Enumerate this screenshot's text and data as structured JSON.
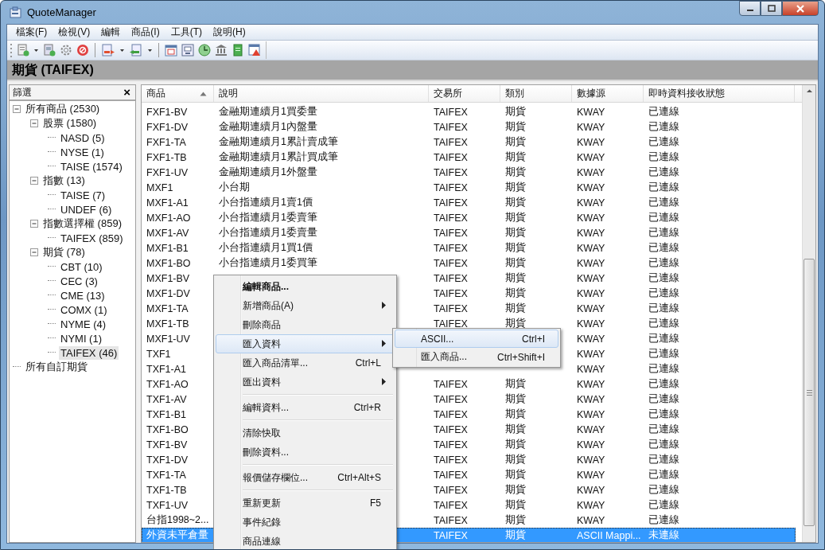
{
  "window": {
    "title": "QuoteManager"
  },
  "menu_bar": [
    {
      "label": "檔案(F)"
    },
    {
      "label": "檢視(V)"
    },
    {
      "label": "編輯"
    },
    {
      "label": "商品(I)"
    },
    {
      "label": "工具(T)"
    },
    {
      "label": "說明(H)"
    }
  ],
  "header": {
    "title": "期貨 (TAIFEX)"
  },
  "filter_panel": {
    "title": "篩選",
    "close": "×",
    "tree": [
      {
        "label": "所有商品 (2530)",
        "expanded": true,
        "selected": false,
        "children": [
          {
            "label": "股票 (1580)",
            "expanded": true,
            "selected": false,
            "children": [
              {
                "label": "NASD (5)",
                "selected": false
              },
              {
                "label": "NYSE (1)",
                "selected": false
              },
              {
                "label": "TAISE (1574)",
                "selected": false
              }
            ]
          },
          {
            "label": "指數 (13)",
            "expanded": true,
            "selected": false,
            "children": [
              {
                "label": "TAISE (7)",
                "selected": false
              },
              {
                "label": "UNDEF (6)",
                "selected": false
              }
            ]
          },
          {
            "label": "指數選擇權 (859)",
            "expanded": true,
            "selected": false,
            "children": [
              {
                "label": "TAIFEX (859)",
                "selected": false
              }
            ]
          },
          {
            "label": "期貨 (78)",
            "expanded": true,
            "selected": false,
            "children": [
              {
                "label": "CBT (10)",
                "selected": false
              },
              {
                "label": "CEC (3)",
                "selected": false
              },
              {
                "label": "CME (13)",
                "selected": false
              },
              {
                "label": "COMX (1)",
                "selected": false
              },
              {
                "label": "NYME (4)",
                "selected": false
              },
              {
                "label": "NYMI (1)",
                "selected": false
              },
              {
                "label": "TAIFEX (46)",
                "selected": true
              }
            ]
          }
        ]
      },
      {
        "label": "所有自訂期貨",
        "selected": false
      }
    ]
  },
  "table": {
    "columns": [
      {
        "label": "商品",
        "sorted": true
      },
      {
        "label": "說明",
        "sorted": false
      },
      {
        "label": "交易所",
        "sorted": false
      },
      {
        "label": "類別",
        "sorted": false
      },
      {
        "label": "數據源",
        "sorted": false
      },
      {
        "label": "即時資料接收狀態",
        "sorted": false
      }
    ],
    "rows": [
      {
        "cells": [
          "FXF1-BV",
          "金融期連續月1買委量",
          "TAIFEX",
          "期貨",
          "KWAY",
          "已連線"
        ],
        "selected": false
      },
      {
        "cells": [
          "FXF1-DV",
          "金融期連續月1內盤量",
          "TAIFEX",
          "期貨",
          "KWAY",
          "已連線"
        ],
        "selected": false
      },
      {
        "cells": [
          "FXF1-TA",
          "金融期連續月1累計賣成筆",
          "TAIFEX",
          "期貨",
          "KWAY",
          "已連線"
        ],
        "selected": false
      },
      {
        "cells": [
          "FXF1-TB",
          "金融期連續月1累計買成筆",
          "TAIFEX",
          "期貨",
          "KWAY",
          "已連線"
        ],
        "selected": false
      },
      {
        "cells": [
          "FXF1-UV",
          "金融期連續月1外盤量",
          "TAIFEX",
          "期貨",
          "KWAY",
          "已連線"
        ],
        "selected": false
      },
      {
        "cells": [
          "MXF1",
          "小台期",
          "TAIFEX",
          "期貨",
          "KWAY",
          "已連線"
        ],
        "selected": false
      },
      {
        "cells": [
          "MXF1-A1",
          "小台指連續月1賣1價",
          "TAIFEX",
          "期貨",
          "KWAY",
          "已連線"
        ],
        "selected": false
      },
      {
        "cells": [
          "MXF1-AO",
          "小台指連續月1委賣筆",
          "TAIFEX",
          "期貨",
          "KWAY",
          "已連線"
        ],
        "selected": false
      },
      {
        "cells": [
          "MXF1-AV",
          "小台指連續月1委賣量",
          "TAIFEX",
          "期貨",
          "KWAY",
          "已連線"
        ],
        "selected": false
      },
      {
        "cells": [
          "MXF1-B1",
          "小台指連續月1買1價",
          "TAIFEX",
          "期貨",
          "KWAY",
          "已連線"
        ],
        "selected": false
      },
      {
        "cells": [
          "MXF1-BO",
          "小台指連續月1委買筆",
          "TAIFEX",
          "期貨",
          "KWAY",
          "已連線"
        ],
        "selected": false
      },
      {
        "cells": [
          "MXF1-BV",
          null,
          "TAIFEX",
          "期貨",
          "KWAY",
          "已連線"
        ],
        "selected": false
      },
      {
        "cells": [
          "MXF1-DV",
          null,
          "TAIFEX",
          "期貨",
          "KWAY",
          "已連線"
        ],
        "selected": false
      },
      {
        "cells": [
          "MXF1-TA",
          null,
          "TAIFEX",
          "期貨",
          "KWAY",
          "已連線"
        ],
        "selected": false
      },
      {
        "cells": [
          "MXF1-TB",
          null,
          "TAIFEX",
          "期貨",
          "KWAY",
          "已連線"
        ],
        "selected": false
      },
      {
        "cells": [
          "MXF1-UV",
          null,
          null,
          null,
          "KWAY",
          "已連線"
        ],
        "selected": false
      },
      {
        "cells": [
          "TXF1",
          null,
          null,
          null,
          "KWAY",
          "已連線"
        ],
        "selected": false
      },
      {
        "cells": [
          "TXF1-A1",
          null,
          null,
          null,
          "KWAY",
          "已連線"
        ],
        "selected": false
      },
      {
        "cells": [
          "TXF1-AO",
          null,
          "TAIFEX",
          "期貨",
          "KWAY",
          "已連線"
        ],
        "selected": false
      },
      {
        "cells": [
          "TXF1-AV",
          null,
          "TAIFEX",
          "期貨",
          "KWAY",
          "已連線"
        ],
        "selected": false
      },
      {
        "cells": [
          "TXF1-B1",
          null,
          "TAIFEX",
          "期貨",
          "KWAY",
          "已連線"
        ],
        "selected": false
      },
      {
        "cells": [
          "TXF1-BO",
          null,
          "TAIFEX",
          "期貨",
          "KWAY",
          "已連線"
        ],
        "selected": false
      },
      {
        "cells": [
          "TXF1-BV",
          null,
          "TAIFEX",
          "期貨",
          "KWAY",
          "已連線"
        ],
        "selected": false
      },
      {
        "cells": [
          "TXF1-DV",
          null,
          "TAIFEX",
          "期貨",
          "KWAY",
          "已連線"
        ],
        "selected": false
      },
      {
        "cells": [
          "TXF1-TA",
          null,
          "TAIFEX",
          "期貨",
          "KWAY",
          "已連線"
        ],
        "selected": false
      },
      {
        "cells": [
          "TXF1-TB",
          null,
          "TAIFEX",
          "期貨",
          "KWAY",
          "已連線"
        ],
        "selected": false
      },
      {
        "cells": [
          "TXF1-UV",
          null,
          "TAIFEX",
          "期貨",
          "KWAY",
          "已連線"
        ],
        "selected": false
      },
      {
        "cells": [
          "台指1998~2...",
          null,
          "TAIFEX",
          "期貨",
          "KWAY",
          "已連線"
        ],
        "selected": false
      },
      {
        "cells": [
          "外資未平倉量",
          null,
          "TAIFEX",
          "期貨",
          "ASCII Mappi...",
          "未連線"
        ],
        "selected": true
      }
    ]
  },
  "context_menu": [
    {
      "kind": "item",
      "label": "編輯商品...",
      "default": true,
      "selected": false
    },
    {
      "kind": "item",
      "label": "新增商品(A)",
      "submenu": true,
      "selected": false
    },
    {
      "kind": "item",
      "label": "刪除商品",
      "selected": false
    },
    {
      "kind": "item",
      "label": "匯入資料",
      "submenu": true,
      "selected": true
    },
    {
      "kind": "item",
      "label": "匯入商品清單...",
      "shortcut": "Ctrl+L",
      "selected": false
    },
    {
      "kind": "item",
      "label": "匯出資料",
      "submenu": true,
      "selected": false
    },
    {
      "kind": "separator"
    },
    {
      "kind": "item",
      "label": "編輯資料...",
      "shortcut": "Ctrl+R",
      "selected": false
    },
    {
      "kind": "separator"
    },
    {
      "kind": "item",
      "label": "清除快取",
      "selected": false
    },
    {
      "kind": "item",
      "label": "刪除資料...",
      "selected": false
    },
    {
      "kind": "separator"
    },
    {
      "kind": "item",
      "label": "報價儲存欄位...",
      "shortcut": "Ctrl+Alt+S",
      "selected": false
    },
    {
      "kind": "separator"
    },
    {
      "kind": "item",
      "label": "重新更新",
      "shortcut": "F5",
      "selected": false
    },
    {
      "kind": "item",
      "label": "事件紀錄",
      "selected": false
    },
    {
      "kind": "item",
      "label": "商品連線",
      "selected": false
    }
  ],
  "submenu": [
    {
      "label": "ASCII...",
      "shortcut": "Ctrl+I",
      "selected": true
    },
    {
      "label": "匯入商品...",
      "shortcut": "Ctrl+Shift+I",
      "selected": false
    }
  ]
}
